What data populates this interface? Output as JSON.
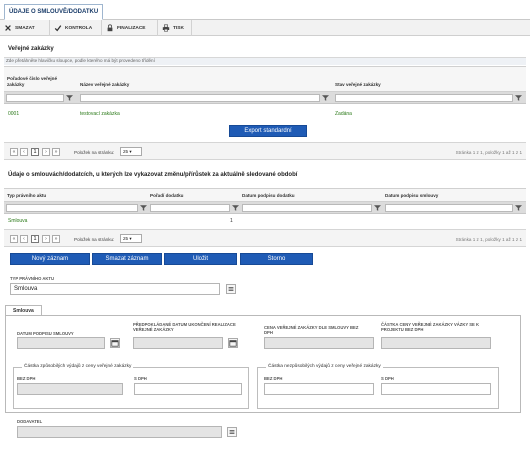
{
  "tab": {
    "label": "ÚDAJE O SMLOUVĚ/DODATKU"
  },
  "toolbar": {
    "storno": "SMAZAT",
    "kontrola": "KONTROLA",
    "finalizace": "FINALIZACE",
    "tisk": "TISK"
  },
  "zakazky": {
    "title": "Veřejné zakázky",
    "hint": "Zde přetáhněte hlavičku sloupce, podle kterého má být provedeno třídění",
    "columns": [
      "Pořadové číslo veřejné zakázky",
      "Název veřejné zakázky",
      "Stav veřejné zakázky"
    ],
    "rows": [
      {
        "cislo": "0001",
        "nazev": "testovací zakázka",
        "stav": "Zadána"
      }
    ],
    "export_label": "Export standardní",
    "pager": {
      "page": "1",
      "per_page_label": "Položek na stránku:",
      "per_page": "25",
      "info": "Stránka 1 z 1, položky 1 až 1 z 1"
    }
  },
  "smlouvy": {
    "title": "Údaje o smlouvách/dodatcích, u kterých lze vykazovat změnu/přírůstek za aktuálně sledované období",
    "columns": [
      "Typ právního aktu",
      "Pořadí dodatku",
      "Datum podpisu dodatku",
      "Datum podpisu smlouvy"
    ],
    "rows": [
      {
        "typ": "Smlouva",
        "poradi": "1",
        "datum_dodatku": "",
        "datum_smlouvy": ""
      }
    ],
    "pager": {
      "page": "1",
      "per_page_label": "Položek na stránku:",
      "per_page": "25",
      "info": "Stránka 1 z 1, položky 1 až 1 z 1"
    }
  },
  "actions": {
    "novy": "Nový záznam",
    "smazat": "Smazat záznam",
    "ulozit": "Uložit",
    "storno": "Storno"
  },
  "form": {
    "typ_label": "TYP PRÁVNÍHO AKTU",
    "typ_value": "Smlouva",
    "subtab": "Smlouva",
    "datum_podpisu_label": "DATUM PODPISU SMLOUVY",
    "predpokladane_label": "PŘEDPOKLÁDANÉ DATUM UKONČENÍ REALIZACE VEŘEJNÉ ZAKÁZKY",
    "cena_label": "CENA VEŘEJNÉ ZAKÁZKY DLE SMLOUVY BEZ DPH",
    "castka_label": "ČÁSTKA CENY VEŘEJNÉ ZAKÁZKY VÁZKY SE K PROJEKTU BEZ DPH",
    "zpusobile_legend": "Částka způsobilých výdajů z ceny veřejné zakázky",
    "nezpusobile_legend": "Částka nezpůsobilých výdajů z ceny veřejné zakázky",
    "bez_dph": "BEZ DPH",
    "s_dph": "S DPH",
    "dodavatel_label": "DODAVATEL"
  }
}
